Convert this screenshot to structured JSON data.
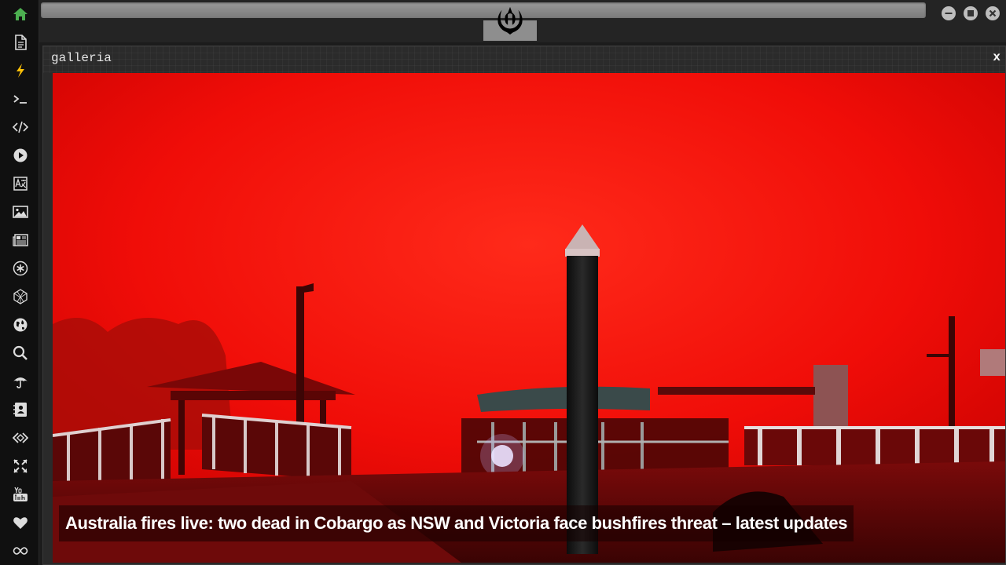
{
  "window": {
    "logo_icon": "rebel-alliance-icon",
    "controls": [
      "minimize-icon",
      "maximize-icon",
      "close-icon"
    ]
  },
  "sidebar": {
    "items": [
      {
        "icon": "home-icon",
        "active": true,
        "color": "#4caf50"
      },
      {
        "icon": "document-icon"
      },
      {
        "icon": "lightning-icon"
      },
      {
        "icon": "terminal-icon"
      },
      {
        "icon": "code-icon"
      },
      {
        "icon": "play-icon"
      },
      {
        "icon": "translate-icon"
      },
      {
        "icon": "image-icon"
      },
      {
        "icon": "newspaper-icon"
      },
      {
        "icon": "asterisk-icon"
      },
      {
        "icon": "polyhedron-icon"
      },
      {
        "icon": "globe-icon"
      },
      {
        "icon": "search-icon"
      },
      {
        "icon": "umbrella-icon"
      },
      {
        "icon": "contact-card-icon"
      },
      {
        "icon": "tag-code-icon"
      },
      {
        "icon": "expand-icon"
      },
      {
        "icon": "youtube-icon"
      },
      {
        "icon": "heart-icon"
      },
      {
        "icon": "infinity-icon"
      }
    ]
  },
  "panel": {
    "title": "galleria",
    "close_label": "x"
  },
  "gallery": {
    "caption": "Australia fires live: two dead in Cobargo as NSW and Victoria face bushfires threat – latest updates",
    "image_subject": "red smoke-filled sky over a jetty with a pier post and boats"
  }
}
